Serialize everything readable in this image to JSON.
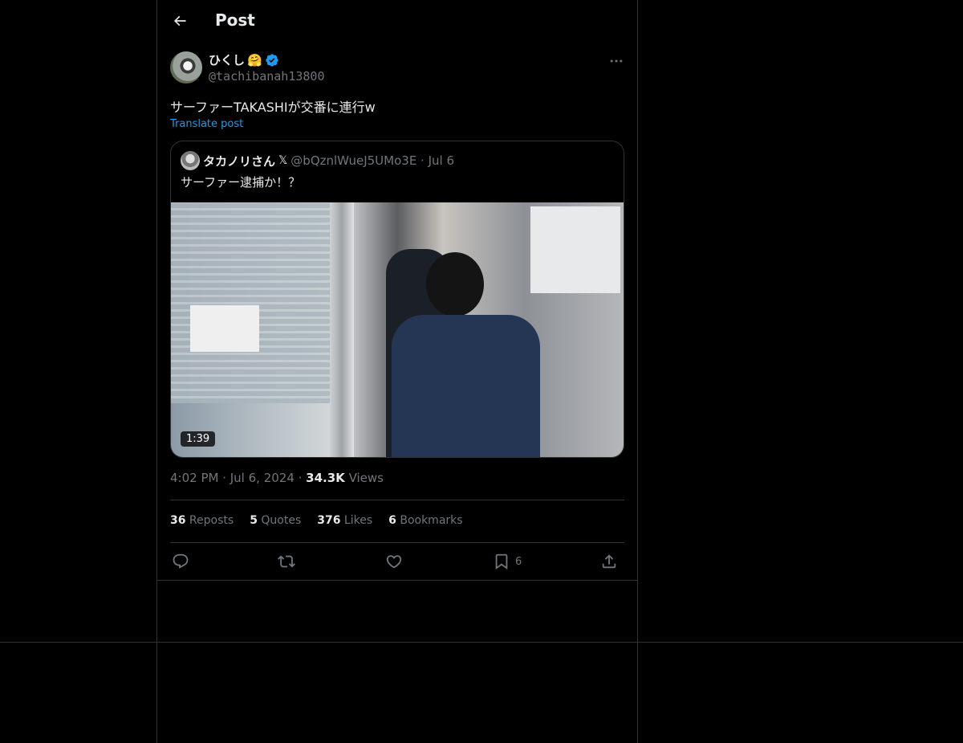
{
  "header": {
    "title": "Post"
  },
  "author": {
    "name": "ひくし",
    "emoji": "🤗",
    "handle": "@tachibanah13800"
  },
  "post": {
    "text": "サーファーTAKASHIが交番に連行w",
    "translate_label": "Translate post",
    "time": "4:02 PM · Jul 6, 2024 · ",
    "views_count": "34.3K",
    "views_label": " Views"
  },
  "quote": {
    "name": "タカノリさん",
    "x_badge": "𝕏",
    "meta": "@bQznlWueJ5UMo3E · Jul 6",
    "text": "サーファー逮捕か！？",
    "video_duration": "1:39"
  },
  "stats": {
    "reposts_count": "36",
    "reposts_label": " Reposts",
    "quotes_count": "5",
    "quotes_label": " Quotes",
    "likes_count": "376",
    "likes_label": " Likes",
    "bookmarks_count": "6",
    "bookmarks_label": " Bookmarks"
  },
  "actions": {
    "reply_icon": "reply-icon",
    "repost_icon": "repost-icon",
    "like_icon": "heart-icon",
    "bookmark_icon": "bookmark-icon",
    "bookmark_count": "6",
    "share_icon": "share-icon"
  },
  "colors": {
    "background": "#000000",
    "border": "#2f3336",
    "accent": "#1d9bf0",
    "muted": "#71767b",
    "text": "#e7e9ea"
  }
}
